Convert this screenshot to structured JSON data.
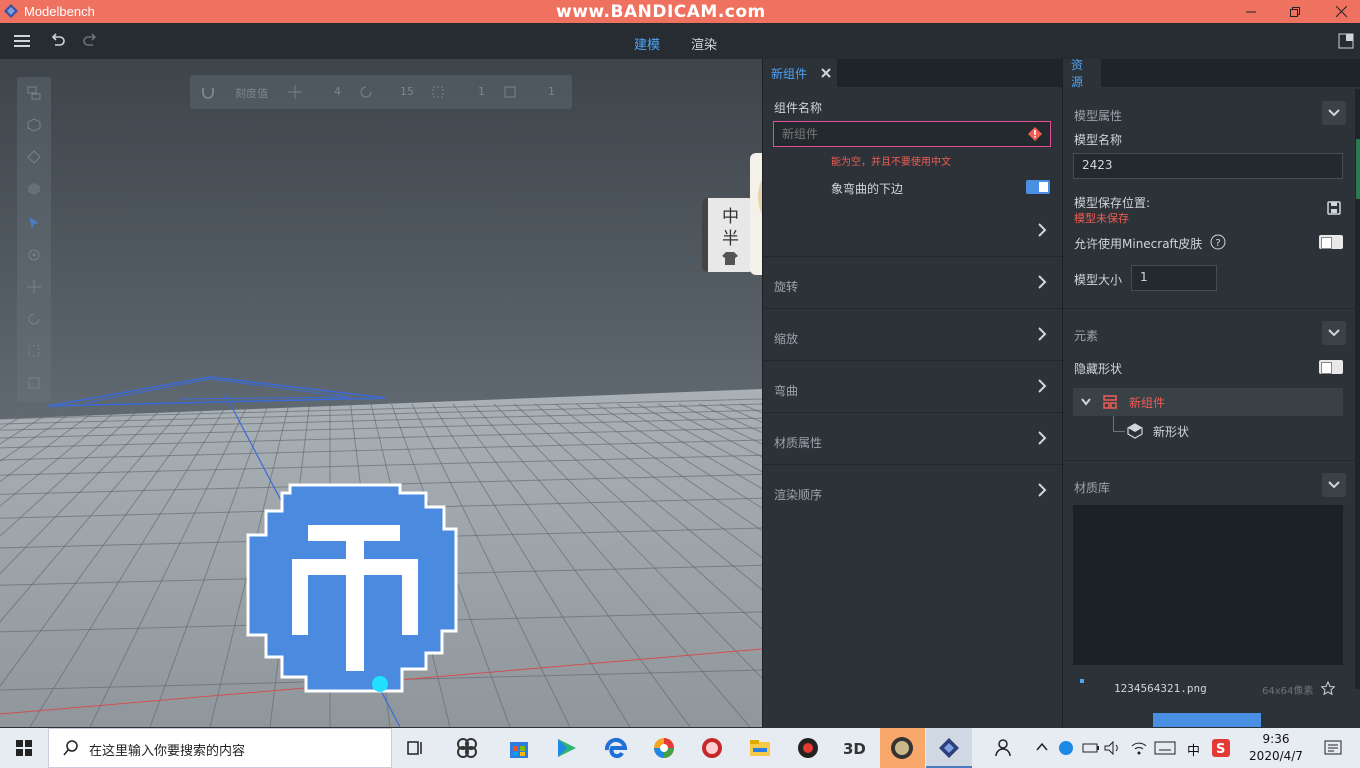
{
  "window": {
    "title": "Modelbench",
    "watermark": "www.BANDICAM.com"
  },
  "topnav": {
    "tabs": [
      {
        "label": "建模",
        "active": true
      },
      {
        "label": "渲染",
        "active": false
      }
    ]
  },
  "snapbar": {
    "label": "刻度值",
    "values": [
      "4",
      "15",
      "1",
      "1"
    ]
  },
  "mid_panel": {
    "tab_label": "新组件",
    "name_label": "组件名称",
    "name_placeholder": "新组件",
    "error_text": "能为空，并且不要使用中文",
    "bend_label": "象弯曲的下边",
    "sections": [
      "旋转",
      "缩放",
      "弯曲",
      "材质属性",
      "渲染顺序"
    ]
  },
  "overlay_chars": [
    "中",
    "半"
  ],
  "right_panel": {
    "tab_label": "资源",
    "model_props": "模型属性",
    "model_name_label": "模型名称",
    "model_name_value": "2423",
    "save_location_label": "模型保存位置:",
    "save_status": "模型未保存",
    "allow_skin_label": "允许使用Minecraft皮肤",
    "model_size_label": "模型大小",
    "model_size_value": "1",
    "elements_label": "元素",
    "hide_shapes_label": "隐藏形状",
    "tree_parent": "新组件",
    "tree_child": "新形状",
    "material_lib_label": "材质库",
    "texture_name": "1234564321.png",
    "texture_size": "64x64像素"
  },
  "taskbar": {
    "search_placeholder": "在这里输入你要搜索的内容",
    "time": "9:36",
    "date": "2020/4/7",
    "ime": "中"
  },
  "colors": {
    "accent": "#4fa3f7",
    "error": "#f25c54",
    "titlebar": "#ef7260"
  }
}
